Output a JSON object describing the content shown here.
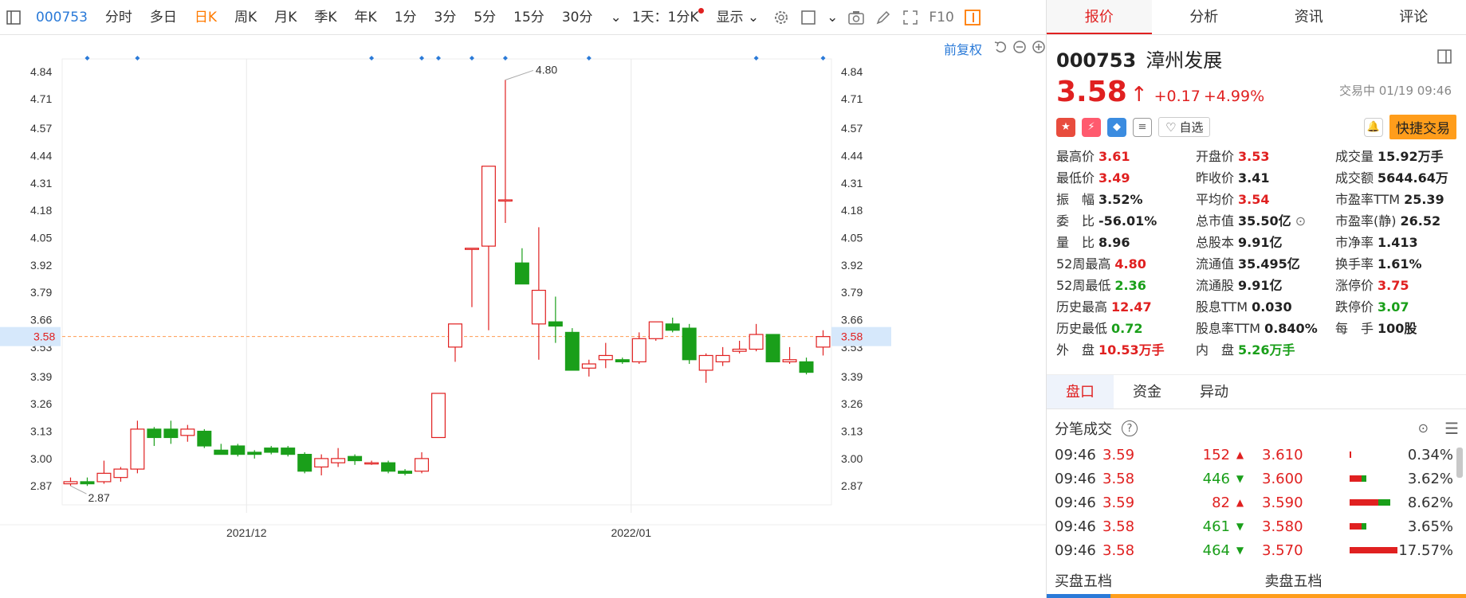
{
  "toolbar": {
    "code": "000753",
    "items": [
      "分时",
      "多日",
      "日K",
      "周K",
      "月K",
      "季K",
      "年K",
      "1分",
      "3分",
      "5分",
      "15分",
      "30分"
    ],
    "active": "日K",
    "period_select": "1天：1分K",
    "display_label": "显示",
    "f10_label": "F10"
  },
  "chart_sub": {
    "fq_label": "前复权"
  },
  "chart_data": {
    "type": "candlestick",
    "y_ticks": [
      4.84,
      4.71,
      4.57,
      4.44,
      4.31,
      4.18,
      4.05,
      3.92,
      3.79,
      3.66,
      3.53,
      3.39,
      3.26,
      3.13,
      3.0,
      2.87
    ],
    "ylim": [
      2.78,
      4.9
    ],
    "x_labels": [
      "2021/12",
      "2022/01"
    ],
    "last_price": "3.58",
    "high_label": "4.80",
    "low_label": "2.87",
    "candles": [
      {
        "o": 2.88,
        "c": 2.89,
        "h": 2.91,
        "l": 2.87
      },
      {
        "o": 2.89,
        "c": 2.88,
        "h": 2.91,
        "l": 2.87
      },
      {
        "o": 2.89,
        "c": 2.93,
        "h": 2.99,
        "l": 2.88
      },
      {
        "o": 2.91,
        "c": 2.95,
        "h": 2.96,
        "l": 2.89
      },
      {
        "o": 2.95,
        "c": 3.14,
        "h": 3.18,
        "l": 2.93
      },
      {
        "o": 3.14,
        "c": 3.1,
        "h": 3.15,
        "l": 3.06
      },
      {
        "o": 3.14,
        "c": 3.1,
        "h": 3.18,
        "l": 3.07
      },
      {
        "o": 3.11,
        "c": 3.14,
        "h": 3.16,
        "l": 3.08
      },
      {
        "o": 3.13,
        "c": 3.06,
        "h": 3.14,
        "l": 3.05
      },
      {
        "o": 3.04,
        "c": 3.02,
        "h": 3.07,
        "l": 3.02
      },
      {
        "o": 3.06,
        "c": 3.02,
        "h": 3.07,
        "l": 3.01
      },
      {
        "o": 3.03,
        "c": 3.02,
        "h": 3.04,
        "l": 3.0
      },
      {
        "o": 3.05,
        "c": 3.03,
        "h": 3.06,
        "l": 3.02
      },
      {
        "o": 3.05,
        "c": 3.02,
        "h": 3.06,
        "l": 3.01
      },
      {
        "o": 3.02,
        "c": 2.94,
        "h": 3.03,
        "l": 2.93
      },
      {
        "o": 2.96,
        "c": 3.0,
        "h": 3.02,
        "l": 2.92
      },
      {
        "o": 2.98,
        "c": 3.0,
        "h": 3.05,
        "l": 2.96
      },
      {
        "o": 3.01,
        "c": 2.99,
        "h": 3.02,
        "l": 2.97
      },
      {
        "o": 2.98,
        "c": 2.98,
        "h": 2.99,
        "l": 2.97
      },
      {
        "o": 2.98,
        "c": 2.94,
        "h": 2.99,
        "l": 2.93
      },
      {
        "o": 2.94,
        "c": 2.93,
        "h": 2.95,
        "l": 2.92
      },
      {
        "o": 2.94,
        "c": 3.0,
        "h": 3.03,
        "l": 2.93
      },
      {
        "o": 3.1,
        "c": 3.31,
        "h": 3.31,
        "l": 3.1
      },
      {
        "o": 3.53,
        "c": 3.64,
        "h": 3.64,
        "l": 3.46
      },
      {
        "o": 4.0,
        "c": 4.0,
        "h": 4.0,
        "l": 3.72
      },
      {
        "o": 4.01,
        "c": 4.39,
        "h": 4.39,
        "l": 3.61
      },
      {
        "o": 4.23,
        "c": 4.23,
        "h": 4.8,
        "l": 4.12
      },
      {
        "o": 3.93,
        "c": 3.83,
        "h": 4.0,
        "l": 3.83
      },
      {
        "o": 3.64,
        "c": 3.8,
        "h": 4.1,
        "l": 3.47
      },
      {
        "o": 3.65,
        "c": 3.63,
        "h": 3.77,
        "l": 3.55
      },
      {
        "o": 3.6,
        "c": 3.42,
        "h": 3.62,
        "l": 3.42
      },
      {
        "o": 3.43,
        "c": 3.45,
        "h": 3.47,
        "l": 3.39
      },
      {
        "o": 3.47,
        "c": 3.49,
        "h": 3.55,
        "l": 3.43
      },
      {
        "o": 3.47,
        "c": 3.46,
        "h": 3.48,
        "l": 3.45
      },
      {
        "o": 3.46,
        "c": 3.57,
        "h": 3.6,
        "l": 3.45
      },
      {
        "o": 3.57,
        "c": 3.65,
        "h": 3.65,
        "l": 3.56
      },
      {
        "o": 3.64,
        "c": 3.61,
        "h": 3.67,
        "l": 3.6
      },
      {
        "o": 3.62,
        "c": 3.47,
        "h": 3.64,
        "l": 3.45
      },
      {
        "o": 3.42,
        "c": 3.49,
        "h": 3.5,
        "l": 3.36
      },
      {
        "o": 3.46,
        "c": 3.49,
        "h": 3.53,
        "l": 3.44
      },
      {
        "o": 3.51,
        "c": 3.52,
        "h": 3.56,
        "l": 3.5
      },
      {
        "o": 3.52,
        "c": 3.59,
        "h": 3.64,
        "l": 3.51
      },
      {
        "o": 3.59,
        "c": 3.46,
        "h": 3.59,
        "l": 3.46
      },
      {
        "o": 3.46,
        "c": 3.47,
        "h": 3.53,
        "l": 3.45
      },
      {
        "o": 3.46,
        "c": 3.41,
        "h": 3.48,
        "l": 3.4
      },
      {
        "o": 3.53,
        "c": 3.58,
        "h": 3.61,
        "l": 3.49
      }
    ],
    "markers": [
      1,
      4,
      18,
      21,
      22,
      24,
      26,
      31,
      41,
      45
    ]
  },
  "stock": {
    "code": "000753",
    "name": "漳州发展",
    "price": "3.58",
    "change": "+0.17",
    "change_pct": "+4.99%",
    "status": "交易中 01/19 09:46",
    "zixuan": "自选",
    "quick_trade": "快捷交易"
  },
  "rtabs": [
    "报价",
    "分析",
    "资讯",
    "评论"
  ],
  "quotes": [
    {
      "label": "最高价",
      "value": "3.61",
      "color": "red"
    },
    {
      "label": "开盘价",
      "value": "3.53",
      "color": "red"
    },
    {
      "label": "成交量",
      "value": "15.92万手",
      "color": "dark"
    },
    {
      "label": "最低价",
      "value": "3.49",
      "color": "red"
    },
    {
      "label": "昨收价",
      "value": "3.41",
      "color": "dark"
    },
    {
      "label": "成交额",
      "value": "5644.64万",
      "color": "dark"
    },
    {
      "label": "振　幅",
      "value": "3.52%",
      "color": "dark"
    },
    {
      "label": "平均价",
      "value": "3.54",
      "color": "red"
    },
    {
      "label": "市盈率TTM",
      "value": "25.39",
      "color": "dark"
    },
    {
      "label": "委　比",
      "value": "-56.01%",
      "color": "dark"
    },
    {
      "label": "总市值",
      "value": "35.50亿",
      "color": "dark"
    },
    {
      "label": "市盈率(静)",
      "value": "26.52",
      "color": "dark"
    },
    {
      "label": "量　比",
      "value": "8.96",
      "color": "dark"
    },
    {
      "label": "总股本",
      "value": "9.91亿",
      "color": "dark"
    },
    {
      "label": "市净率",
      "value": "1.413",
      "color": "dark"
    },
    {
      "label": "52周最高",
      "value": "4.80",
      "color": "red"
    },
    {
      "label": "流通值",
      "value": "35.495亿",
      "color": "dark"
    },
    {
      "label": "换手率",
      "value": "1.61%",
      "color": "dark"
    },
    {
      "label": "52周最低",
      "value": "2.36",
      "color": "green"
    },
    {
      "label": "流通股",
      "value": "9.91亿",
      "color": "dark"
    },
    {
      "label": "涨停价",
      "value": "3.75",
      "color": "red"
    },
    {
      "label": "历史最高",
      "value": "12.47",
      "color": "red"
    },
    {
      "label": "股息TTM",
      "value": "0.030",
      "color": "dark"
    },
    {
      "label": "跌停价",
      "value": "3.07",
      "color": "green"
    },
    {
      "label": "历史最低",
      "value": "0.72",
      "color": "green"
    },
    {
      "label": "股息率TTM",
      "value": "0.840%",
      "color": "dark"
    },
    {
      "label": "每　手",
      "value": "100股",
      "color": "dark"
    },
    {
      "label": "外　盘",
      "value": "10.53万手",
      "color": "red"
    },
    {
      "label": "内　盘",
      "value": "5.26万手",
      "color": "green"
    }
  ],
  "sec_tabs": [
    "盘口",
    "资金",
    "异动"
  ],
  "fb_title": "分笔成交",
  "trades": [
    {
      "time": "09:46",
      "price": "3.59",
      "vol": "152",
      "dir": "up"
    },
    {
      "time": "09:46",
      "price": "3.58",
      "vol": "446",
      "dir": "down"
    },
    {
      "time": "09:46",
      "price": "3.59",
      "vol": "82",
      "dir": "up"
    },
    {
      "time": "09:46",
      "price": "3.58",
      "vol": "461",
      "dir": "down"
    },
    {
      "time": "09:46",
      "price": "3.58",
      "vol": "464",
      "dir": "down"
    }
  ],
  "levels": [
    {
      "price": "3.610",
      "pct": "0.34%",
      "r": 0.03,
      "g": 0.0
    },
    {
      "price": "3.600",
      "pct": "3.62%",
      "r": 0.25,
      "g": 0.1
    },
    {
      "price": "3.590",
      "pct": "8.62%",
      "r": 0.6,
      "g": 0.25
    },
    {
      "price": "3.580",
      "pct": "3.65%",
      "r": 0.25,
      "g": 0.1
    },
    {
      "price": "3.570",
      "pct": "17.57%",
      "r": 1.0,
      "g": 0.0
    }
  ],
  "bottom": {
    "buy5": "买盘五档",
    "sell5": "卖盘五档"
  },
  "colors": {
    "up": "#e02020",
    "down": "#1a9f1a",
    "accent": "#ff7a00",
    "blue": "#2a7ad8"
  }
}
